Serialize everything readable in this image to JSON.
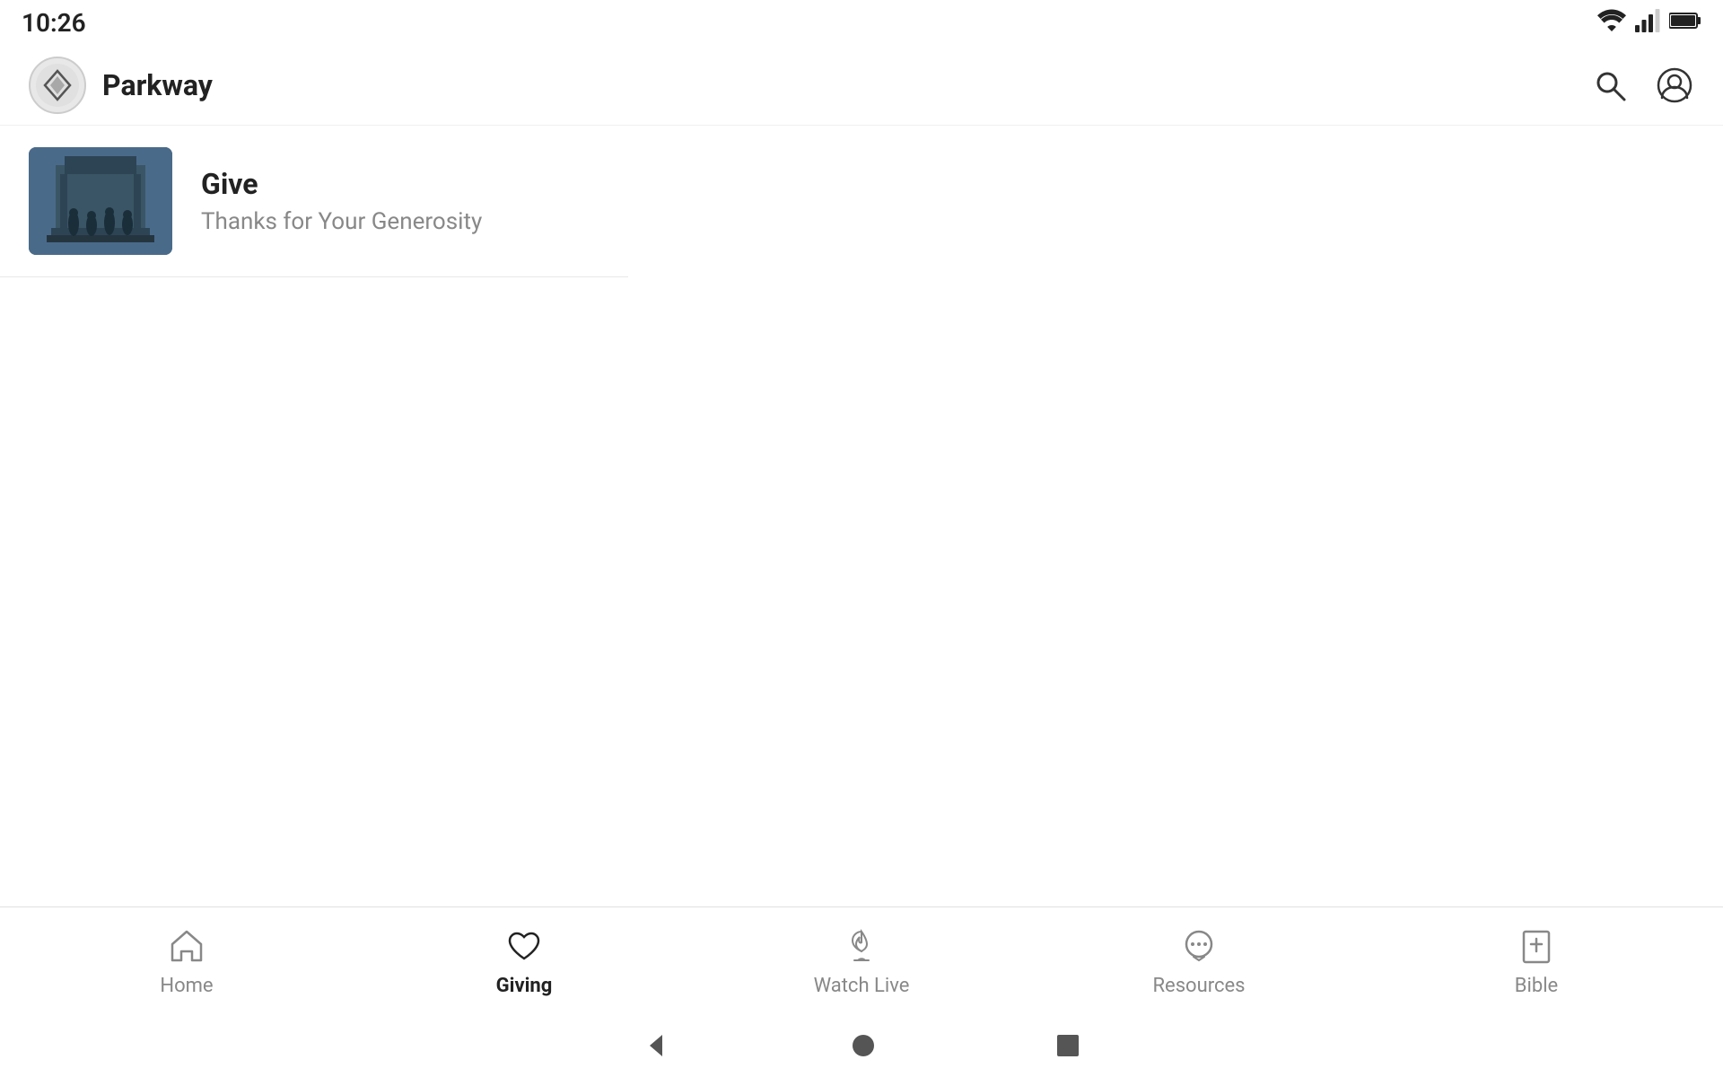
{
  "statusBar": {
    "time": "10:26"
  },
  "header": {
    "appName": "Parkway",
    "logoAlt": "Parkway logo"
  },
  "give": {
    "title": "Give",
    "subtitle": "Thanks for Your Generosity"
  },
  "bottomNav": {
    "items": [
      {
        "id": "home",
        "label": "Home",
        "active": false
      },
      {
        "id": "giving",
        "label": "Giving",
        "active": true
      },
      {
        "id": "watch-live",
        "label": "Watch Live",
        "active": false
      },
      {
        "id": "resources",
        "label": "Resources",
        "active": false
      },
      {
        "id": "bible",
        "label": "Bible",
        "active": false
      }
    ]
  },
  "colors": {
    "activeNav": "#222222",
    "inactiveNav": "#888888",
    "accent": "#222222"
  }
}
